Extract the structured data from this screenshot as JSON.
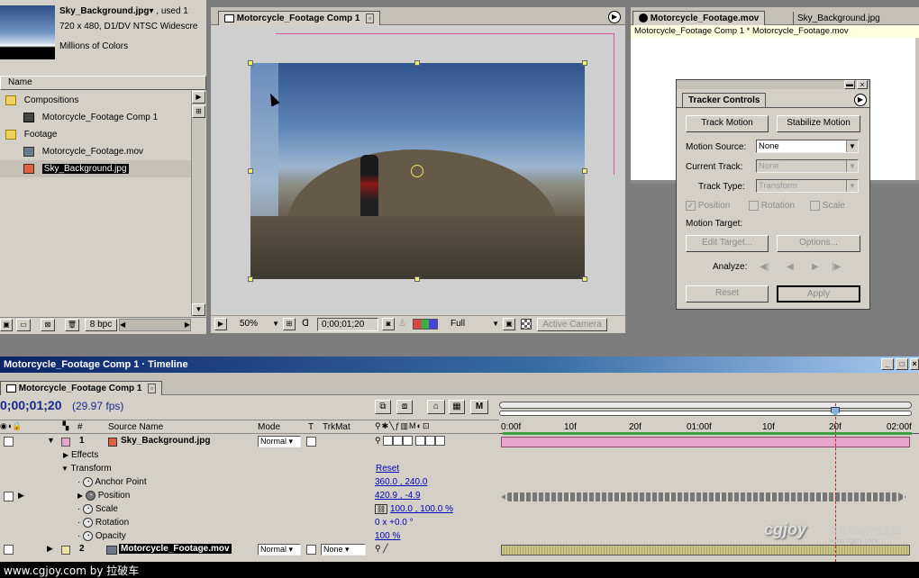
{
  "project": {
    "footage_name": "Sky_Background.jpg",
    "used_suffix": "▾ , used 1",
    "footage_info": "720 x 480, D1/DV NTSC Widescre",
    "footage_colors": "Millions of Colors",
    "col_name": "Name",
    "items": [
      {
        "label": "Compositions",
        "type": "folder"
      },
      {
        "label": "Motorcycle_Footage Comp 1",
        "type": "comp"
      },
      {
        "label": "Footage",
        "type": "folder"
      },
      {
        "label": "Motorcycle_Footage.mov",
        "type": "movie"
      },
      {
        "label": "Sky_Background.jpg",
        "type": "image"
      }
    ],
    "bpc": "8 bpc"
  },
  "comp": {
    "tab": "Motorcycle_Footage Comp 1",
    "zoom": "50%",
    "timecode": "0;00;01;20",
    "resolution": "Full",
    "camera": "Active Camera"
  },
  "layer_window": {
    "tab1": "Motorcycle_Footage.mov",
    "tab2": "Sky_Background.jpg",
    "subtitle": "Motorcycle_Footage Comp 1 * Motorcycle_Footage.mov"
  },
  "tracker": {
    "title": "Tracker Controls",
    "track_motion": "Track Motion",
    "stabilize_motion": "Stabilize Motion",
    "motion_source_label": "Motion Source:",
    "motion_source_value": "None",
    "current_track_label": "Current Track:",
    "current_track_value": "None",
    "track_type_label": "Track Type:",
    "track_type_value": "Transform",
    "position": "Position",
    "rotation": "Rotation",
    "scale": "Scale",
    "motion_target_label": "Motion Target:",
    "edit_target": "Edit Target...",
    "options": "Options...",
    "analyze_label": "Analyze:",
    "reset": "Reset",
    "apply": "Apply"
  },
  "timeline": {
    "window_title": "Motorcycle_Footage Comp 1 · Timeline",
    "tab": "Motorcycle_Footage Comp 1",
    "timecode": "0;00;01;20",
    "fps": "(29.97 fps)",
    "col_num": "#",
    "col_source": "Source Name",
    "col_mode": "Mode",
    "col_t": "T",
    "col_trkmat": "TrkMat",
    "ruler": [
      "0:00f",
      "10f",
      "20f",
      "01:00f",
      "10f",
      "20f",
      "02:00f"
    ],
    "layers": [
      {
        "num": "1",
        "name": "Sky_Background.jpg",
        "mode": "Normal",
        "trkmat": "",
        "color": "#e7a6c9"
      },
      {
        "num": "2",
        "name": "Motorcycle_Footage.mov",
        "mode": "Normal",
        "trkmat": "None",
        "color": "#e8e3a0"
      }
    ],
    "effects_label": "Effects",
    "transform_label": "Transform",
    "transform_reset": "Reset",
    "props": [
      {
        "name": "Anchor Point",
        "value": "360.0 , 240.0"
      },
      {
        "name": "Position",
        "value": "420.9 , -4.9"
      },
      {
        "name": "Scale",
        "value": "100.0 , 100.0 %"
      },
      {
        "name": "Rotation",
        "value": "0 x +0.0 °"
      },
      {
        "name": "Opacity",
        "value": "100 %"
      }
    ]
  },
  "watermark": {
    "bottom": "www.cgjoy.com by 拉破车",
    "logo": "cgjoy",
    "logo_cn": "游戏动画特技论坛",
    "url": "www.cgjoy.com"
  }
}
